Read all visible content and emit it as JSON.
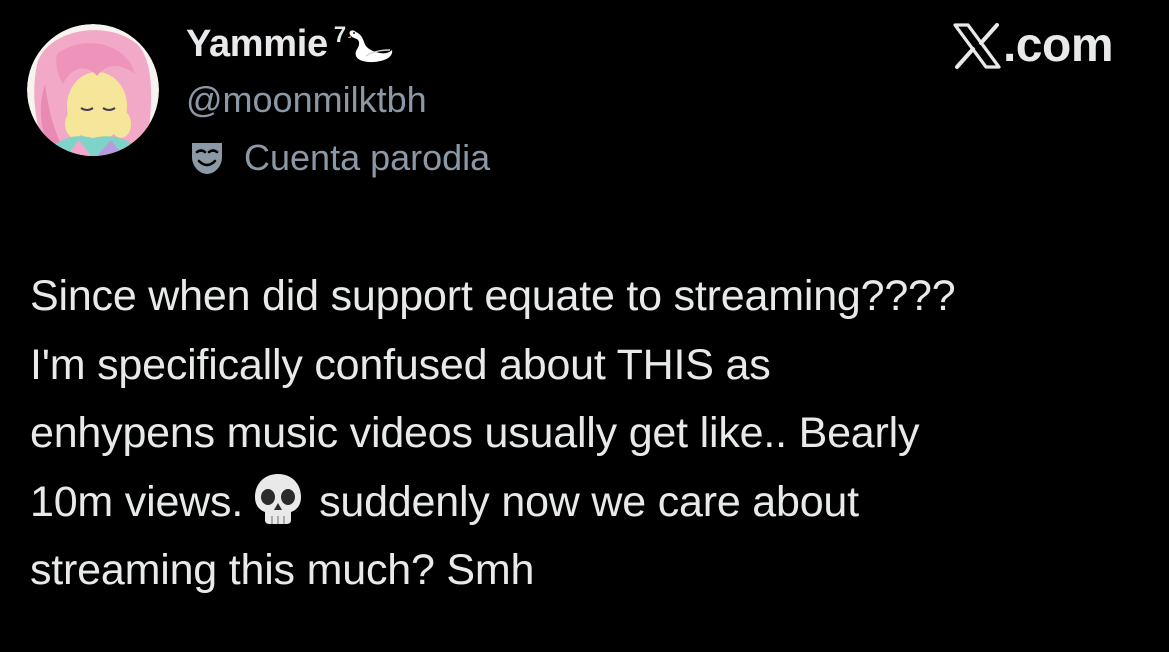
{
  "author": {
    "display_name": "Yammie",
    "name_superscript": "7",
    "name_emoji": "swan-icon",
    "handle": "@moonmilktbh",
    "parody_label": "Cuenta parodia",
    "parody_icon": "theater-mask-icon",
    "avatar": "avatar-image"
  },
  "brand": {
    "icon": "x-logo-icon",
    "domain": ".com"
  },
  "tweet": {
    "lines": [
      "Since when did support equate to streaming????",
      "I'm specifically confused about THIS as",
      "enhypens music videos usually get like.. Bearly",
      "10m views.",
      "suddenly now we care about",
      "streaming this much? Smh"
    ],
    "inline_emoji": "skull-icon"
  },
  "colors": {
    "background": "#000000",
    "primary_text": "#e7e9ea",
    "secondary_text": "#8b98a5"
  }
}
